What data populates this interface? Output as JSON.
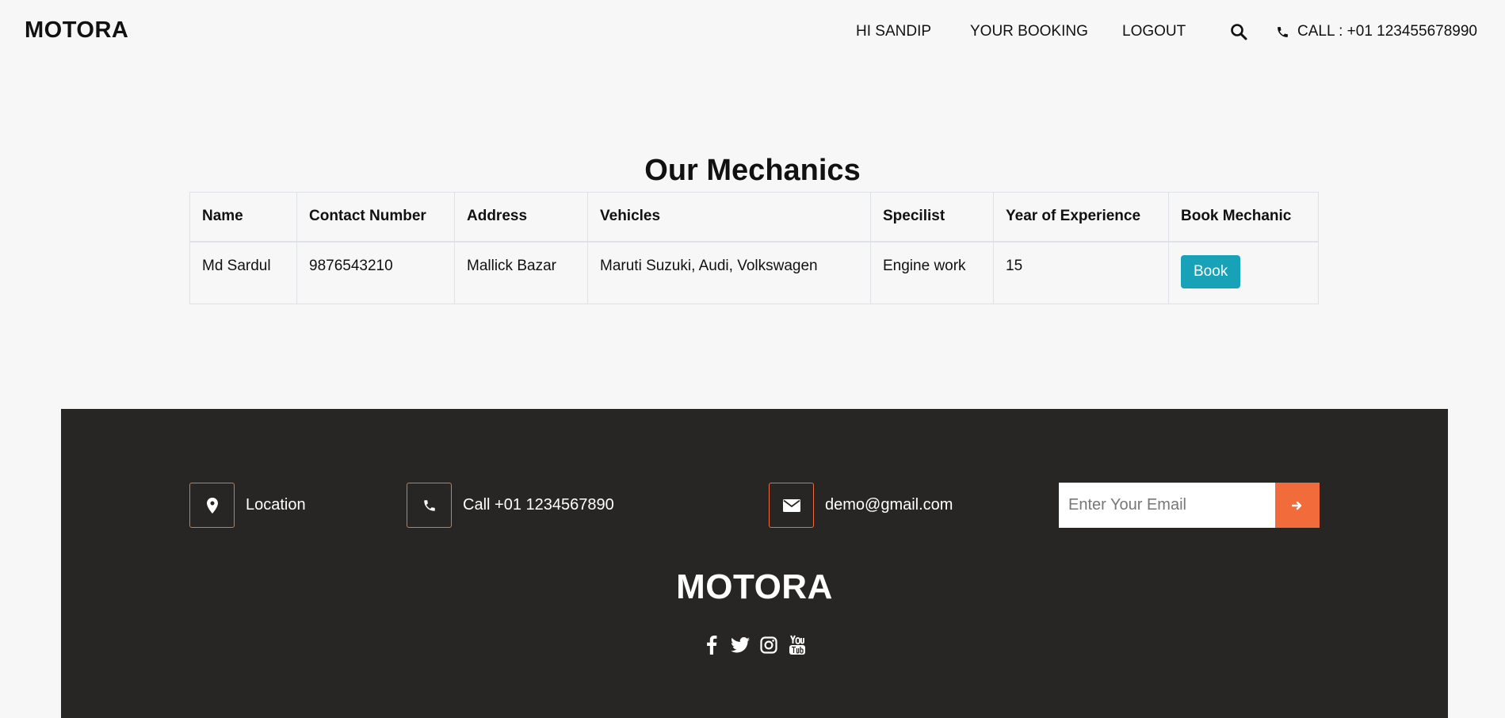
{
  "header": {
    "brand": "MOTORA",
    "nav": [
      {
        "label": "HI SANDIP"
      },
      {
        "label": "YOUR BOOKING"
      },
      {
        "label": "LOGOUT"
      }
    ],
    "search_icon": "search-icon",
    "call_label": "CALL : +01 123455678990"
  },
  "main": {
    "title": "Our Mechanics",
    "columns": [
      "Name",
      "Contact Number",
      "Address",
      "Vehicles",
      "Specilist",
      "Year of Experience",
      "Book Mechanic"
    ],
    "rows": [
      {
        "name": "Md Sardul",
        "contact": "9876543210",
        "address": "Mallick Bazar",
        "vehicles": "Maruti Suzuki, Audi, Volkswagen",
        "specialist": "Engine work",
        "experience": "15",
        "book_label": "Book"
      }
    ]
  },
  "footer": {
    "location": "Location",
    "call": "Call +01 1234567890",
    "email": "demo@gmail.com",
    "newsletter_placeholder": "Enter Your Email",
    "brand": "MOTORA",
    "socials": [
      "facebook-icon",
      "twitter-icon",
      "instagram-icon",
      "youtube-icon"
    ]
  },
  "colors": {
    "background": "#f7f7f7",
    "footer_bg": "#282624",
    "accent": "#f26b3a",
    "book_button": "#17a2b8"
  }
}
